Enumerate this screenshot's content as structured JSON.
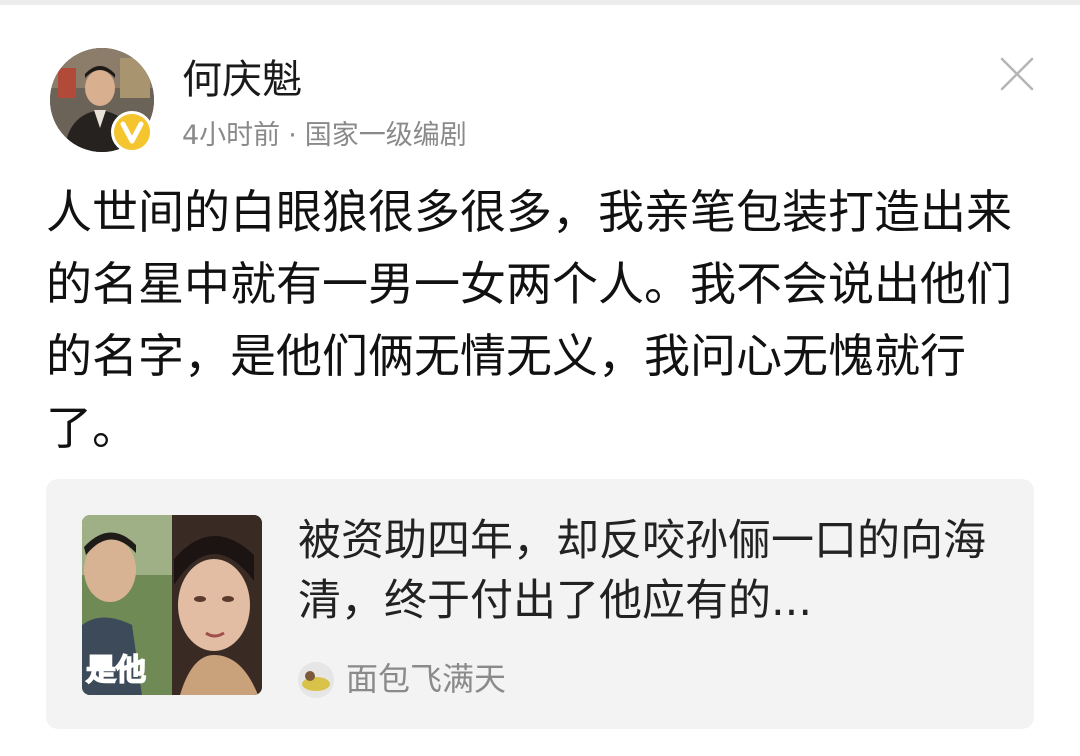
{
  "post": {
    "author": {
      "name": "何庆魁",
      "avatar_icon": "person-avatar",
      "verified_icon": "verified-v-badge-icon"
    },
    "meta": {
      "time": "4小时前",
      "separator": "·",
      "title": "国家一级编剧"
    },
    "body": "人世间的白眼狼很多很多，我亲笔包装打造出来的名星中就有一男一女两个人。我不会说出他们的名字，是他们俩无情无义，我问心无愧就行了。",
    "close_icon": "close-icon"
  },
  "linked_article": {
    "thumbnail_caption": "是他",
    "title": "被资助四年，却反咬孙俪一口的向海清，终于付出了他应有的...",
    "source": "面包飞满天"
  },
  "colors": {
    "badge": "#f4c52e",
    "card_background": "#f3f3f3",
    "secondary_text": "#8a8a8a",
    "thumbnail_caption": "#e52020"
  }
}
